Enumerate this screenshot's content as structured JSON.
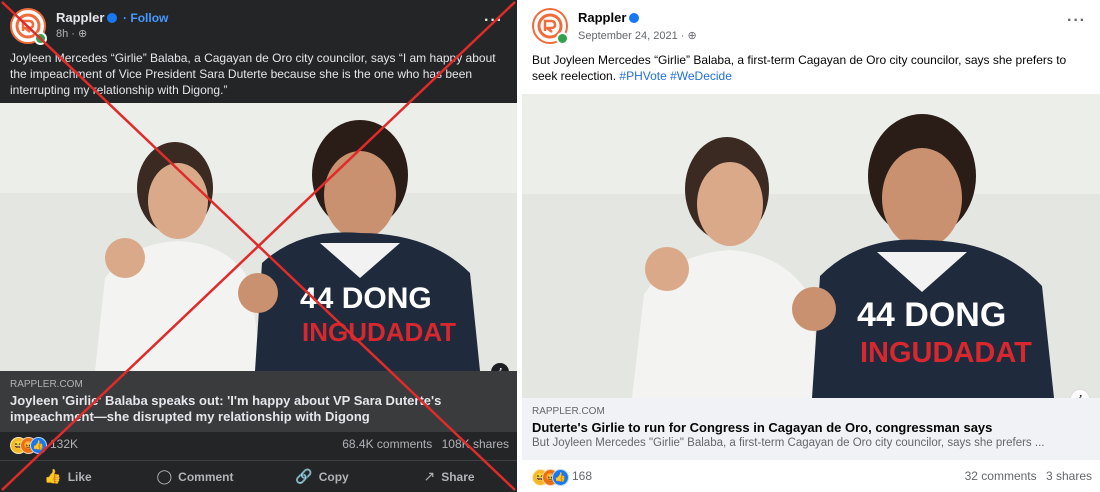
{
  "colors": {
    "x_mark": "#e02b2b",
    "dark_card": "#242526",
    "link_blue": "#216fdb"
  },
  "fake_post": {
    "page_name": "Rappler",
    "follow": "· Follow",
    "meta": "8h ·",
    "caption": "Joyleen Mercedes “Girlie” Balaba, a Cagayan de Oro city councilor, says “I am happy about the impeachment of Vice President Sara Duterte because she is the one who has been interrupting my relationship with Digong.”",
    "link_domain": "RAPPLER.COM",
    "link_title": "Joyleen 'Girlie' Balaba speaks out: 'I'm happy about VP Sara Duterte's impeachment—she disrupted my relationship with Digong",
    "reaction_count": "132K",
    "comments": "68.4K comments",
    "shares": "108K shares",
    "actions": {
      "like": "Like",
      "comment": "Comment",
      "copy": "Copy",
      "share": "Share"
    }
  },
  "real_post": {
    "page_name": "Rappler",
    "meta": "September 24, 2021 ·",
    "caption": "But Joyleen Mercedes “Girlie” Balaba, a first-term Cagayan de Oro city councilor, says she prefers to seek reelection.",
    "hashtags": "#PHVote #WeDecide",
    "link_domain": "RAPPLER.COM",
    "link_title": "Duterte's Girlie to run for Congress in Cagayan de Oro, congressman says",
    "link_desc": "But Joyleen Mercedes \"Girlie\" Balaba, a first-term Cagayan de Oro city councilor, says she prefers ...",
    "reaction_count": "168",
    "comments": "32 comments",
    "shares": "3 shares"
  },
  "icons": {
    "more": "···",
    "info": "i",
    "globe": "globe-icon",
    "haha": "😆",
    "angry": "😡",
    "like": "👍"
  }
}
